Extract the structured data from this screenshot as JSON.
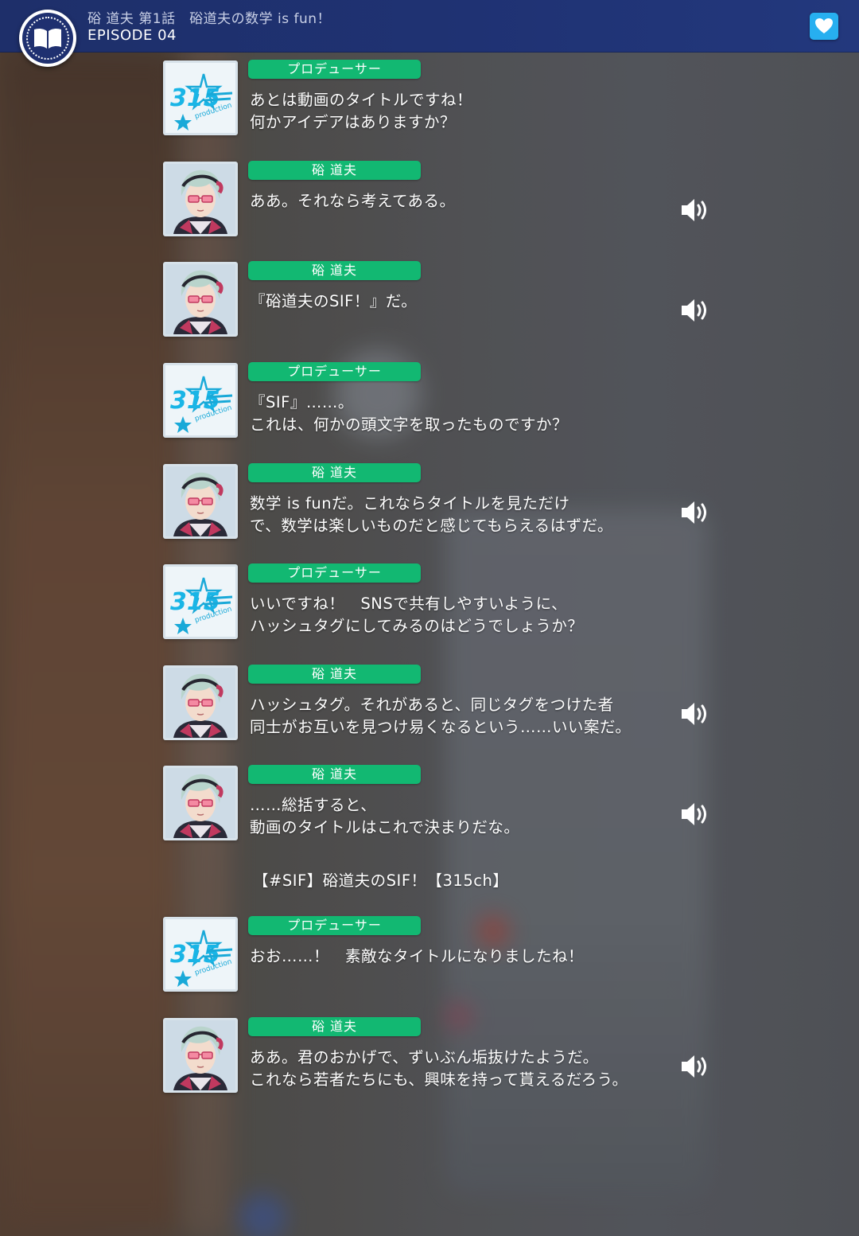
{
  "header": {
    "title": "硲 道夫 第1話　硲道夫の数学 is fun！",
    "episode": "EPISODE 04",
    "menu_icon": "book-icon",
    "favorite_icon": "heart-icon",
    "header_color": "#1f3273",
    "favorite_color": "#27aff0"
  },
  "nameplate_color": "#12b872",
  "logo_text": "315",
  "logo_sub": "production",
  "messages": [
    {
      "speaker": "プロデューサー",
      "lines": [
        "あとは動画のタイトルですね！",
        "何かアイデアはありますか？"
      ],
      "voice": false
    },
    {
      "speaker": "硲 道夫",
      "lines": [
        "ああ。それなら考えてある。",
        ""
      ],
      "voice": true
    },
    {
      "speaker": "硲 道夫",
      "lines": [
        "『硲道夫のSIF！』だ。",
        ""
      ],
      "voice": true
    },
    {
      "speaker": "プロデューサー",
      "lines": [
        "『SIF』……。",
        "これは、何かの頭文字を取ったものですか？"
      ],
      "voice": false
    },
    {
      "speaker": "硲 道夫",
      "lines": [
        "数学 is funだ。これならタイトルを見ただけ",
        "で、数学は楽しいものだと感じてもらえるはずだ。"
      ],
      "voice": true
    },
    {
      "speaker": "プロデューサー",
      "lines": [
        "いいですね！　SNSで共有しやすいように、",
        "ハッシュタグにしてみるのはどうでしょうか？"
      ],
      "voice": false
    },
    {
      "speaker": "硲 道夫",
      "lines": [
        "ハッシュタグ。それがあると、同じタグをつけた者",
        "同士がお互いを見つけ易くなるという……いい案だ。"
      ],
      "voice": true
    },
    {
      "speaker": "硲 道夫",
      "lines": [
        "……総括すると、",
        "動画のタイトルはこれで決まりだな。"
      ],
      "voice": true
    },
    {
      "speaker": "プロデューサー",
      "lines": [
        "おお……！　素敵なタイトルになりましたね！",
        ""
      ],
      "voice": false
    },
    {
      "speaker": "硲 道夫",
      "lines": [
        "ああ。君のおかげで、ずいぶん垢抜けたようだ。",
        "これなら若者たちにも、興味を持って貰えるだろう。"
      ],
      "voice": true
    }
  ],
  "narration": "【#SIF】硲道夫のSIF！【315ch】"
}
